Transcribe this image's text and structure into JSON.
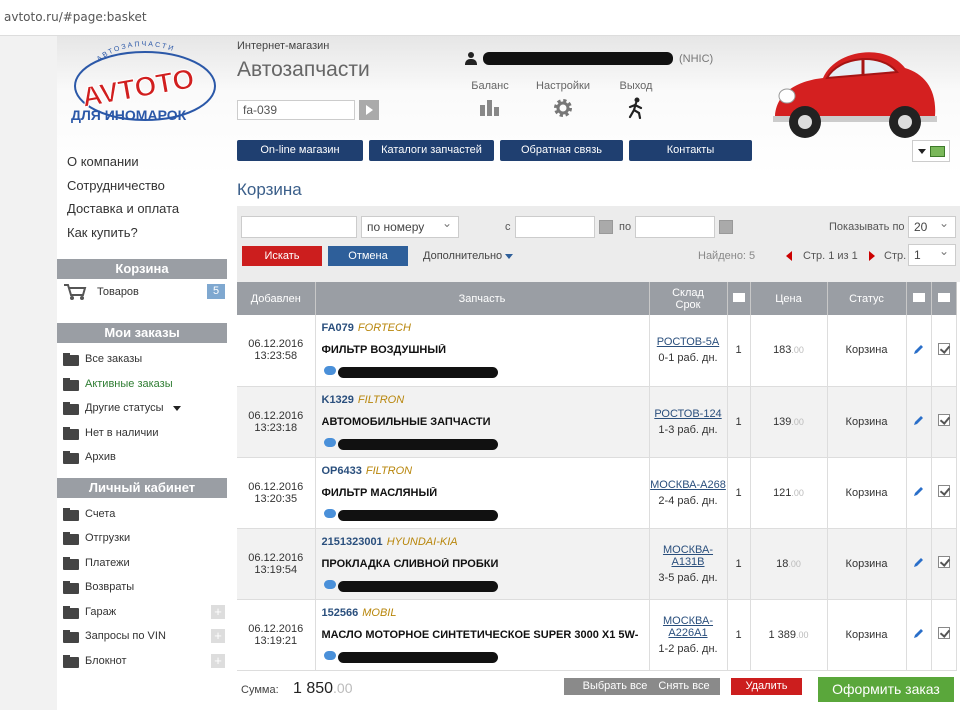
{
  "browser": {
    "url": "avtoto.ru/#page:basket"
  },
  "logo": {
    "brand": "AVTOTO",
    "arc_text": "АВТОЗАПЧАСТИ",
    "tagline": "ДЛЯ ИНОМАРОК"
  },
  "header": {
    "subtitle": "Интернет-магазин",
    "title": "Автозапчасти",
    "search_value": "fa-039",
    "user_suffix": "(NHIC)",
    "links": [
      {
        "label": "Баланс",
        "icon": "chart-icon"
      },
      {
        "label": "Настройки",
        "icon": "gear-icon"
      },
      {
        "label": "Выход",
        "icon": "runner-icon"
      }
    ]
  },
  "nav": [
    "On-line магазин",
    "Каталоги запчастей",
    "Обратная связь",
    "Контакты"
  ],
  "sidebar": {
    "top_links": [
      "О компании",
      "Сотрудничество",
      "Доставка и оплата",
      "Как купить?"
    ],
    "basket": {
      "title": "Корзина",
      "item_label": "Товаров",
      "count": "5"
    },
    "orders": {
      "title": "Мои заказы",
      "items": [
        "Все заказы",
        "Активные заказы",
        "Другие статусы",
        "Нет в наличии",
        "Архив"
      ]
    },
    "cabinet": {
      "title": "Личный кабинет",
      "items": [
        "Счета",
        "Отгрузки",
        "Платежи",
        "Возвраты",
        "Гараж",
        "Запросы по VIN",
        "Блокнот"
      ]
    }
  },
  "main": {
    "title": "Корзина",
    "filter": {
      "search_mode": "по номеру",
      "from_label": "с",
      "to_label": "по",
      "show_label": "Показывать по",
      "show_value": "20",
      "search_button": "Искать",
      "cancel_button": "Отмена",
      "more_label": "Дополнительно",
      "found": "Найдено: 5",
      "pages": "Стр. 1 из 1",
      "page_label": "Стр.",
      "page_value": "1"
    },
    "columns": [
      "Добавлен",
      "Запчасть",
      "Склад",
      "Срок",
      "Цена",
      "Статус"
    ],
    "rows": [
      {
        "date": "06.12.2016",
        "time": "13:23:58",
        "code": "FA079",
        "brand": "FORTECH",
        "name": "ФИЛЬТР ВОЗДУШНЫЙ",
        "stock": "РОСТОВ-5А",
        "stock2": "",
        "days": "0-1 раб. дн.",
        "qty": "1",
        "price": "183",
        "cents": ".00",
        "status": "Корзина"
      },
      {
        "date": "06.12.2016",
        "time": "13:23:18",
        "code": "K1329",
        "brand": "FILTRON",
        "name": "АВТОМОБИЛЬНЫЕ ЗАПЧАСТИ",
        "stock": "РОСТОВ-124",
        "stock2": "",
        "days": "1-3 раб. дн.",
        "qty": "1",
        "price": "139",
        "cents": ".00",
        "status": "Корзина"
      },
      {
        "date": "06.12.2016",
        "time": "13:20:35",
        "code": "OP6433",
        "brand": "FILTRON",
        "name": "ФИЛЬТР МАСЛЯНЫЙ",
        "stock": "МОСКВА-А268",
        "stock2": "",
        "days": "2-4 раб. дн.",
        "qty": "1",
        "price": "121",
        "cents": ".00",
        "status": "Корзина"
      },
      {
        "date": "06.12.2016",
        "time": "13:19:54",
        "code": "2151323001",
        "brand": "HYUNDAI-KIA",
        "name": "ПРОКЛАДКА СЛИВНОЙ ПРОБКИ",
        "stock": "МОСКВА-",
        "stock2": "А131В",
        "days": "3-5 раб. дн.",
        "qty": "1",
        "price": "18",
        "cents": ".00",
        "status": "Корзина"
      },
      {
        "date": "06.12.2016",
        "time": "13:19:21",
        "code": "152566",
        "brand": "MOBIL",
        "name": "МАСЛО МОТОРНОЕ СИНТЕТИЧЕСКОЕ SUPER 3000 X1 5W-",
        "stock": "МОСКВА-",
        "stock2": "А226А1",
        "days": "1-2 раб. дн.",
        "qty": "1",
        "price": "1 389",
        "cents": ".00",
        "status": "Корзина"
      }
    ],
    "footer": {
      "sum_label": "Сумма:",
      "sum_value": "1 850",
      "sum_cents": ".00",
      "select_all": "Выбрать все",
      "deselect_all": "Снять все",
      "delete": "Удалить",
      "checkout": "Оформить заказ"
    }
  },
  "colors": {
    "nav_blue": "#1f3f70",
    "red": "#cc1e1e",
    "blue_btn": "#2e5f9a",
    "green": "#5aa73b",
    "head_gray": "#9a9ea4"
  }
}
